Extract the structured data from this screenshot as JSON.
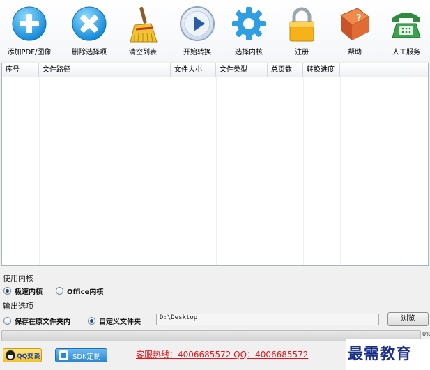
{
  "toolbar": {
    "buttons": [
      {
        "label": "添加PDF/图像",
        "icon": "plus-icon"
      },
      {
        "label": "删除选择项",
        "icon": "delete-icon"
      },
      {
        "label": "清空列表",
        "icon": "broom-icon"
      },
      {
        "label": "开始转换",
        "icon": "play-icon"
      },
      {
        "label": "选择内核",
        "icon": "gear-icon"
      },
      {
        "label": "注册",
        "icon": "lock-icon"
      },
      {
        "label": "帮助",
        "icon": "help-book-icon"
      },
      {
        "label": "人工服务",
        "icon": "phone-icon"
      }
    ]
  },
  "table": {
    "columns": [
      "序号",
      "文件路径",
      "文件大小",
      "文件类型",
      "总页数",
      "转换进度"
    ]
  },
  "engine": {
    "title": "使用内核",
    "options": [
      "极速内核",
      "Office内核"
    ],
    "selected": 0
  },
  "output": {
    "title": "输出选项",
    "options": [
      "保存在原文件夹内",
      "自定义文件夹"
    ],
    "selected": 1,
    "path": "D:\\Desktop",
    "browse_label": "浏览"
  },
  "progress": {
    "value": 0,
    "percent_text": "0%"
  },
  "bottom": {
    "qq_label": "QQ交谈",
    "sdk_label": "SDK定制",
    "hotline": "客服热线：4006685572 QQ：4006685572"
  },
  "watermark": "最需教育",
  "colors": {
    "accent": "#2c9a3c",
    "hotline": "#e8141b",
    "watermark": "#1a2f8a"
  }
}
